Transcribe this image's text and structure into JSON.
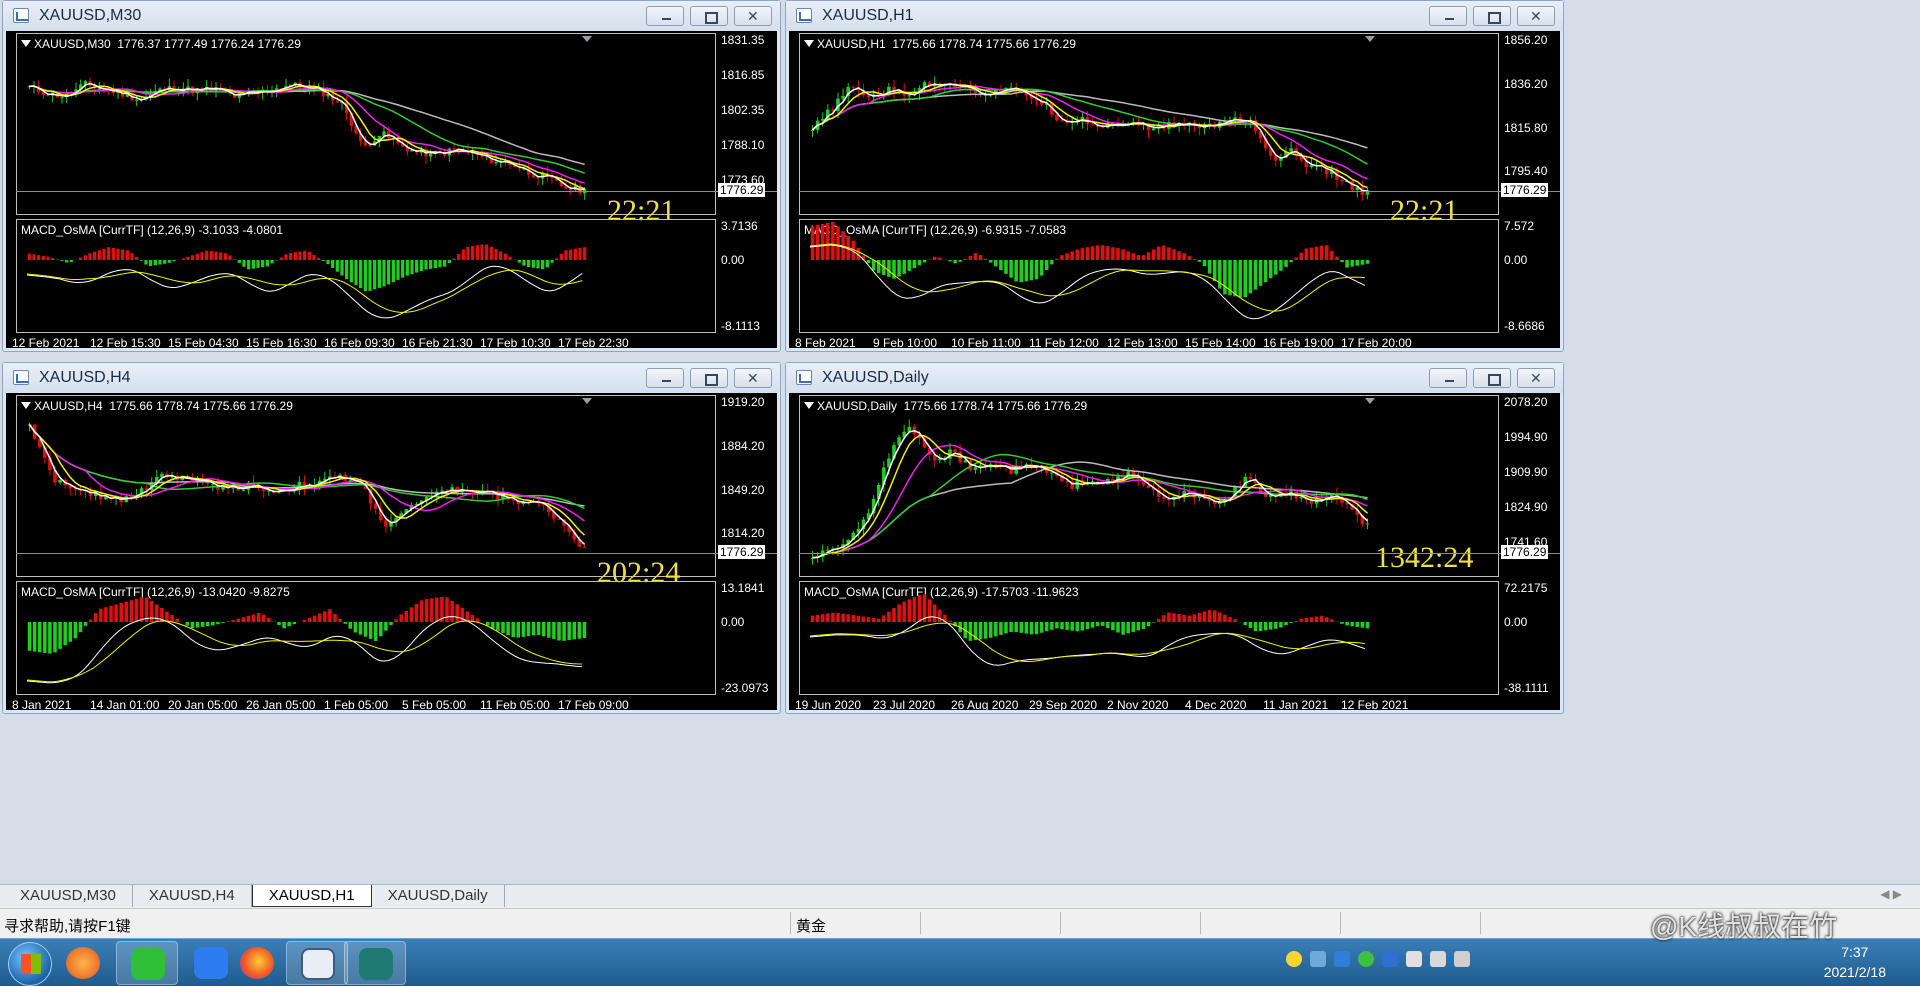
{
  "charts": [
    {
      "id": "m30",
      "title": "XAUUSD,M30",
      "label": "XAUUSD,M30  1776.37 1777.49 1776.24 1776.29",
      "countdown": "22:21",
      "price": "1776.29",
      "y_ticks": [
        "1831.35",
        "1816.85",
        "1802.35",
        "1788.10",
        "1773.60"
      ],
      "macd_label": "MACD_OsMA [CurrTF] (12,26,9) -3.1033 -4.0801",
      "macd_ticks": [
        "3.7136",
        "0.00",
        "-8.1113"
      ],
      "x_ticks": [
        "12 Feb 2021",
        "12 Feb 15:30",
        "15 Feb 04:30",
        "15 Feb 16:30",
        "16 Feb 09:30",
        "16 Feb 21:30",
        "17 Feb 10:30",
        "17 Feb 22:30"
      ]
    },
    {
      "id": "h1",
      "title": "XAUUSD,H1",
      "label": "XAUUSD,H1  1775.66 1778.74 1775.66 1776.29",
      "countdown": "22:21",
      "price": "1776.29",
      "y_ticks": [
        "1856.20",
        "1836.20",
        "1815.80",
        "1795.40"
      ],
      "macd_label": "MACD_OsMA [CurrTF] (12,26,9) -6.9315 -7.0583",
      "macd_ticks": [
        "7.572",
        "0.00",
        "-8.6686"
      ],
      "x_ticks": [
        "8 Feb 2021",
        "9 Feb 10:00",
        "10 Feb 11:00",
        "11 Feb 12:00",
        "12 Feb 13:00",
        "15 Feb 14:00",
        "16 Feb 19:00",
        "17 Feb 20:00"
      ]
    },
    {
      "id": "h4",
      "title": "XAUUSD,H4",
      "label": "XAUUSD,H4  1775.66 1778.74 1775.66 1776.29",
      "countdown": "202:24",
      "price": "1776.29",
      "y_ticks": [
        "1919.20",
        "1884.20",
        "1849.20",
        "1814.20"
      ],
      "macd_label": "MACD_OsMA [CurrTF] (12,26,9) -13.0420 -9.8275",
      "macd_ticks": [
        "13.1841",
        "0.00",
        "-23.0973"
      ],
      "x_ticks": [
        "8 Jan 2021",
        "14 Jan 01:00",
        "20 Jan 05:00",
        "26 Jan 05:00",
        "1 Feb 05:00",
        "5 Feb 05:00",
        "11 Feb 05:00",
        "17 Feb 09:00"
      ]
    },
    {
      "id": "d1",
      "title": "XAUUSD,Daily",
      "label": "XAUUSD,Daily  1775.66 1778.74 1775.66 1776.29",
      "countdown": "1342:24",
      "price": "1776.29",
      "y_ticks": [
        "2078.20",
        "1994.90",
        "1909.90",
        "1824.90",
        "1741.60"
      ],
      "macd_label": "MACD_OsMA [CurrTF] (12,26,9) -17.5703 -11.9623",
      "macd_ticks": [
        "72.2175",
        "0.00",
        "-38.1111"
      ],
      "x_ticks": [
        "19 Jun 2020",
        "23 Jul 2020",
        "26 Aug 2020",
        "29 Sep 2020",
        "2 Nov 2020",
        "4 Dec 2020",
        "11 Jan 2021",
        "12 Feb 2021"
      ]
    }
  ],
  "tabs": [
    "XAUUSD,M30",
    "XAUUSD,H4",
    "XAUUSD,H1",
    "XAUUSD,Daily"
  ],
  "active_tab": "XAUUSD,H1",
  "status": {
    "help": "寻求帮助,请按F1键",
    "symbol": "黄金"
  },
  "clock": {
    "time": "7:37",
    "date": "2021/2/18"
  },
  "watermark": "@K线叔叔在竹",
  "taskbar": [
    "start-button",
    "media-player",
    "wechat",
    "feishu",
    "firefox",
    "calculator",
    "app-window"
  ],
  "colors": {
    "bull": "#22cc22",
    "bear": "#dd1111",
    "ma_fast": "#ffffff",
    "ma_yellow": "#f2f200",
    "ma_magenta": "#ee22ee",
    "ma_green": "#33cc33",
    "ma_gray": "#bbbbbb",
    "countdown": "#f0e040"
  }
}
